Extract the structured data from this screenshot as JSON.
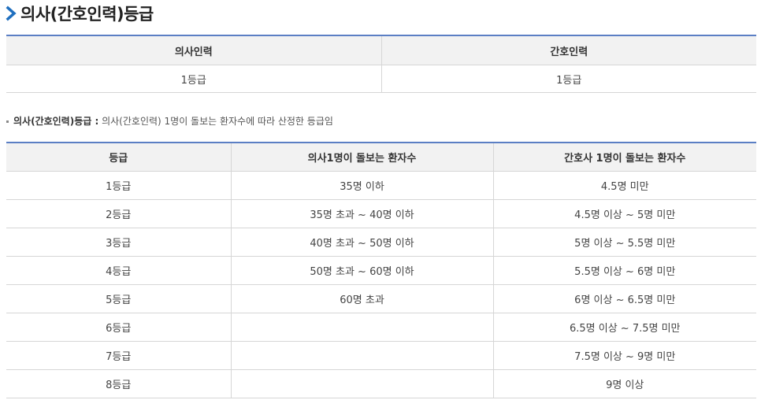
{
  "page": {
    "title": "의사(간호인력)등급"
  },
  "summary_table": {
    "headers": [
      "의사인력",
      "간호인력"
    ],
    "values": [
      "1등급",
      "1등급"
    ]
  },
  "note": {
    "label": "의사(간호인력)등급 :",
    "text": " 의사(간호인력) 1명이 돌보는 환자수에 따라 산정한 등급임"
  },
  "grade_table": {
    "headers": [
      "등급",
      "의사1명이 돌보는 환자수",
      "간호사 1명이 돌보는 환자수"
    ],
    "rows": [
      [
        "1등급",
        "35명 이하",
        "4.5명 미만"
      ],
      [
        "2등급",
        "35명 초과 ~ 40명 이하",
        "4.5명 이상 ~ 5명 미만"
      ],
      [
        "3등급",
        "40명 초과 ~ 50명 이하",
        "5명 이상 ~ 5.5명 미만"
      ],
      [
        "4등급",
        "50명 초과 ~ 60명 이하",
        "5.5명 이상 ~ 6명 미만"
      ],
      [
        "5등급",
        "60명 초과",
        "6명 이상 ~ 6.5명 미만"
      ],
      [
        "6등급",
        "",
        "6.5명 이상 ~ 7.5명 미만"
      ],
      [
        "7등급",
        "",
        "7.5명 이상 ~ 9명 미만"
      ],
      [
        "8등급",
        "",
        "9명 이상"
      ]
    ]
  },
  "colors": {
    "accent_border": "#5b7fc4",
    "header_bg": "#f2f2f2",
    "chevron": "#1f6fbf"
  }
}
